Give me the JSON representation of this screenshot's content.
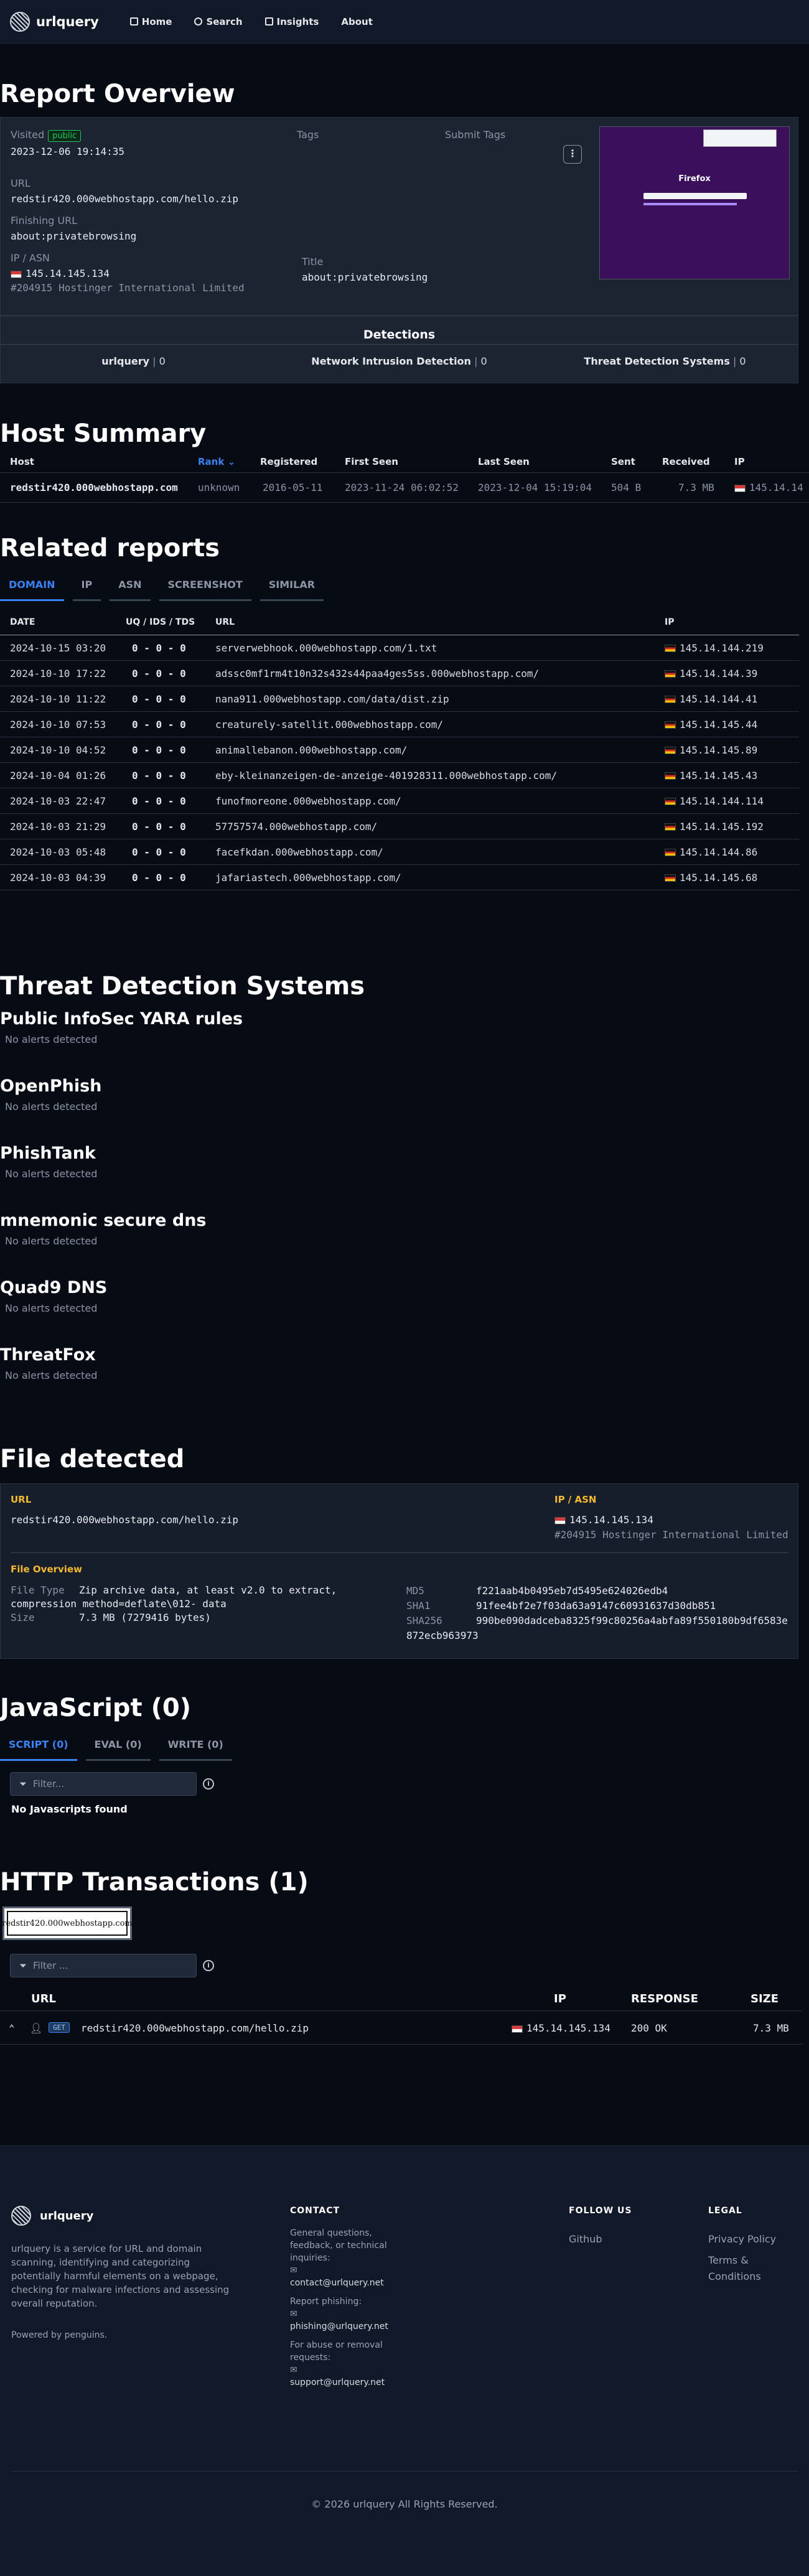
{
  "nav": {
    "brand": "urlquery",
    "links": [
      "Home",
      "Search",
      "Insights",
      "About"
    ]
  },
  "overview": {
    "title": "Report Overview",
    "visited_label": "Visited",
    "public_badge": "public",
    "visited_value": "2023-12-06 19:14:35",
    "tags_label": "Tags",
    "submit_tags_label": "Submit Tags",
    "url_label": "URL",
    "url_value": "redstir420.000webhostapp.com/hello.zip",
    "finishing_label": "Finishing URL",
    "finishing_value": "about:privatebrowsing",
    "ipasn_label": "IP / ASN",
    "ip_value": "145.14.145.134",
    "asn_value": "#204915 Hostinger International Limited",
    "title_label": "Title",
    "title_value": "about:privatebrowsing",
    "detections_title": "Detections",
    "detections": [
      {
        "name": "urlquery",
        "count": "0"
      },
      {
        "name": "Network Intrusion Detection",
        "count": "0"
      },
      {
        "name": "Threat Detection Systems",
        "count": "0"
      }
    ],
    "screenshot_brand": "Firefox"
  },
  "host_summary": {
    "title": "Host Summary",
    "headers": [
      "Host",
      "Rank",
      "Registered",
      "First Seen",
      "Last Seen",
      "Sent",
      "Received",
      "IP"
    ],
    "row": [
      "redstir420.000webhostapp.com",
      "unknown",
      "2016-05-11",
      "2023-11-24 06:02:52",
      "2023-12-04 15:19:04",
      "504 B",
      "7.3 MB",
      "145.14.14"
    ]
  },
  "related": {
    "title": "Related reports",
    "tabs": [
      "DOMAIN",
      "IP",
      "ASN",
      "SCREENSHOT",
      "SIMILAR"
    ],
    "headers": [
      "DATE",
      "UQ / IDS / TDS",
      "URL",
      "IP"
    ],
    "rows": [
      {
        "date": "2024-10-15 03:20",
        "counts": "0 - 0 - 0",
        "url": "serverwebhook.000webhostapp.com/1.txt",
        "ip": "145.14.144.219"
      },
      {
        "date": "2024-10-10 17:22",
        "counts": "0 - 0 - 0",
        "url": "adssc0mf1rm4t10n32s432s44paa4ges5ss.000webhostapp.com/",
        "ip": "145.14.144.39"
      },
      {
        "date": "2024-10-10 11:22",
        "counts": "0 - 0 - 0",
        "url": "nana911.000webhostapp.com/data/dist.zip",
        "ip": "145.14.144.41"
      },
      {
        "date": "2024-10-10 07:53",
        "counts": "0 - 0 - 0",
        "url": "creaturely-satellit.000webhostapp.com/",
        "ip": "145.14.145.44"
      },
      {
        "date": "2024-10-10 04:52",
        "counts": "0 - 0 - 0",
        "url": "animallebanon.000webhostapp.com/",
        "ip": "145.14.145.89"
      },
      {
        "date": "2024-10-04 01:26",
        "counts": "0 - 0 - 0",
        "url": "eby-kleinanzeigen-de-anzeige-401928311.000webhostapp.com/",
        "ip": "145.14.145.43"
      },
      {
        "date": "2024-10-03 22:47",
        "counts": "0 - 0 - 0",
        "url": "funofmoreone.000webhostapp.com/",
        "ip": "145.14.144.114"
      },
      {
        "date": "2024-10-03 21:29",
        "counts": "0 - 0 - 0",
        "url": "57757574.000webhostapp.com/",
        "ip": "145.14.145.192"
      },
      {
        "date": "2024-10-03 05:48",
        "counts": "0 - 0 - 0",
        "url": "facefkdan.000webhostapp.com/",
        "ip": "145.14.144.86"
      },
      {
        "date": "2024-10-03 04:39",
        "counts": "0 - 0 - 0",
        "url": "jafariastech.000webhostapp.com/",
        "ip": "145.14.145.68"
      }
    ]
  },
  "tds": {
    "title": "Threat Detection Systems",
    "systems": [
      {
        "name": "Public InfoSec YARA rules",
        "status": "No alerts detected"
      },
      {
        "name": "OpenPhish",
        "status": "No alerts detected"
      },
      {
        "name": "PhishTank",
        "status": "No alerts detected"
      },
      {
        "name": "mnemonic secure dns",
        "status": "No alerts detected"
      },
      {
        "name": "Quad9 DNS",
        "status": "No alerts detected"
      },
      {
        "name": "ThreatFox",
        "status": "No alerts detected"
      }
    ]
  },
  "file": {
    "title": "File detected",
    "url_label": "URL",
    "url_value": "redstir420.000webhostapp.com/hello.zip",
    "ipasn_label": "IP / ASN",
    "ip_value": "145.14.145.134",
    "asn_value": "#204915 Hostinger International Limited",
    "overview_label": "File Overview",
    "filetype_label": "File Type",
    "filetype_value": "Zip archive data, at least v2.0 to extract,",
    "filetype_value2": "compression method=deflate\\012- data",
    "size_label": "Size",
    "size_value": "7.3 MB (7279416 bytes)",
    "md5_label": "MD5",
    "md5_value": "f221aab4b0495eb7d5495e624026edb4",
    "sha1_label": "SHA1",
    "sha1_value": "91fee4bf2e7f03da63a9147c60931637d30db851",
    "sha256_label": "SHA256",
    "sha256_value": "990be090dadceba8325f99c80256a4abfa89f550180b9df6583e",
    "sha256_value2": "872ecb963973"
  },
  "javascript": {
    "title": "JavaScript (0)",
    "tabs": [
      "SCRIPT (0)",
      "EVAL (0)",
      "WRITE (0)"
    ],
    "filter_placeholder": "Filter...",
    "empty": "No Javascripts found"
  },
  "http": {
    "title": "HTTP Transactions (1)",
    "host_chip": "redstir420.000webhostapp.com",
    "filter_placeholder": "Filter ...",
    "headers": [
      "URL",
      "IP",
      "RESPONSE",
      "SIZE"
    ],
    "row": {
      "method": "GET",
      "url": "redstir420.000webhostapp.com/hello.zip",
      "ip": "145.14.145.134",
      "response": "200 OK",
      "size": "7.3 MB"
    }
  },
  "footer": {
    "brand": "urlquery",
    "description": "urlquery is a service for URL and domain scanning, identifying and categorizing potentially harmful elements on a webpage, checking for malware infections and assessing overall reputation.",
    "powered": "Powered by penguins.",
    "contact_title": "CONTACT",
    "contact_general": "General questions, feedback, or technical inquiries:",
    "contact_email": "contact@urlquery.net",
    "phishing_label": "Report phishing:",
    "phishing_email": "phishing@urlquery.net",
    "abuse_label": "For abuse or removal requests:",
    "support_email": "support@urlquery.net",
    "follow_title": "FOLLOW US",
    "follow_link": "Github",
    "legal_title": "LEGAL",
    "privacy": "Privacy Policy",
    "terms": "Terms & Conditions",
    "copyright": "© 2026 urlquery All Rights Reserved."
  }
}
